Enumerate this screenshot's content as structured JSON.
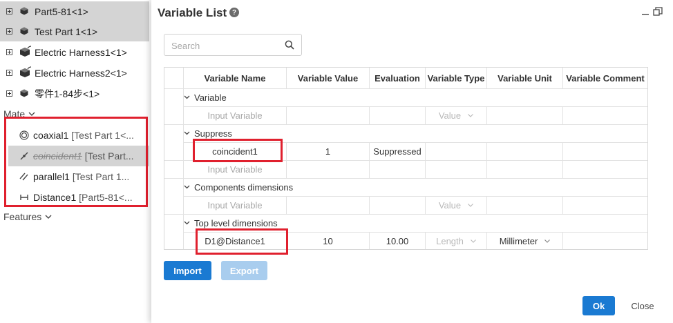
{
  "tree": {
    "parts": [
      {
        "label": "Part5-81<1>",
        "icon": "part-icon",
        "selected": true
      },
      {
        "label": "Test Part 1<1>",
        "icon": "part-icon",
        "selected": true
      },
      {
        "label": "Electric Harness1<1>",
        "icon": "harness-icon",
        "selected": false
      },
      {
        "label": "Electric Harness2<1>",
        "icon": "harness-icon",
        "selected": false
      },
      {
        "label": "零件1-84步<1>",
        "icon": "part-icon",
        "selected": false
      }
    ],
    "mate_header": "Mate",
    "mates": [
      {
        "name": "coaxial1",
        "ref": " [Test Part 1<...",
        "icon": "coaxial-icon",
        "suppressed": false
      },
      {
        "name": "coincident1",
        "ref": " [Test Part...",
        "icon": "coincident-icon",
        "suppressed": true
      },
      {
        "name": "parallel1",
        "ref": " [Test Part 1...",
        "icon": "parallel-icon",
        "suppressed": false
      },
      {
        "name": "Distance1",
        "ref": " [Part5-81<...",
        "icon": "distance-icon",
        "suppressed": false
      }
    ],
    "features_header": "Features"
  },
  "dialog": {
    "title": "Variable List",
    "search_placeholder": "Search",
    "columns": [
      "Variable Name",
      "Variable Value",
      "Evaluation",
      "Variable Type",
      "Variable Unit",
      "Variable Comment"
    ],
    "groups": {
      "variable": "Variable",
      "suppress": "Suppress",
      "components": "Components dimensions",
      "top": "Top level dimensions"
    },
    "input_placeholder": "Input Variable",
    "type_placeholder": "Value",
    "rows": {
      "suppress_row": {
        "name": "coincident1",
        "value": "1",
        "evaluation": "Suppressed"
      },
      "top_row": {
        "name": "D1@Distance1",
        "value": "10",
        "evaluation": "10.00",
        "type": "Length",
        "unit": "Millimeter"
      }
    },
    "buttons": {
      "import": "Import",
      "export": "Export",
      "ok": "Ok",
      "close": "Close"
    },
    "colors": {
      "accent": "#1a7ad2",
      "highlight": "#e0202e"
    }
  }
}
